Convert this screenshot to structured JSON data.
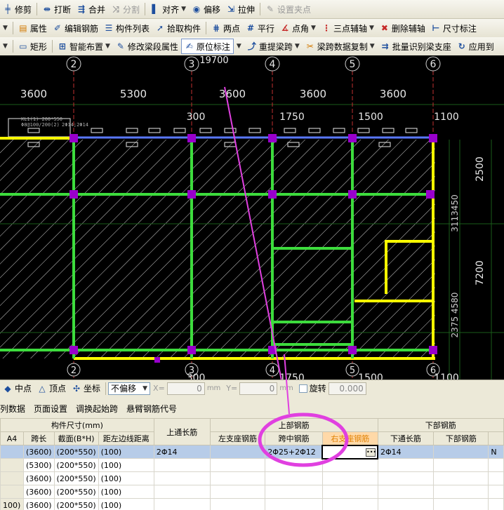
{
  "toolbar1": {
    "trim": "修剪",
    "break": "打断",
    "merge": "合并",
    "split": "分割",
    "align": "对齐",
    "offset": "偏移",
    "stretch": "拉伸",
    "set_grip": "设置夹点"
  },
  "toolbar2": {
    "properties": "属性",
    "edit_rebar": "编辑钢筋",
    "member_list": "构件列表",
    "pick_member": "拾取构件",
    "two_points": "两点",
    "parallel": "平行",
    "point_angle": "点角",
    "three_point_axis": "三点辅轴",
    "delete_axis": "删除辅轴",
    "dim_label": "尺寸标注"
  },
  "toolbar3": {
    "rectangle": "矩形",
    "smart_layout": "智能布置",
    "modify_span_props": "修改梁段属性",
    "in_situ_label": "原位标注",
    "re_extract_span": "重提梁跨",
    "copy_span_data": "梁跨数据复制",
    "batch_identify": "批量识别梁支座",
    "apply_to": "应用到"
  },
  "drawing": {
    "axis_top": [
      "2",
      "3",
      "4",
      "5",
      "6"
    ],
    "axis_bottom": [
      "2",
      "3",
      "4",
      "5",
      "6"
    ],
    "dim_overall": "19700",
    "spans_top": [
      "3600",
      "5300",
      "3600",
      "3600",
      "3600"
    ],
    "offsets": [
      "300",
      "1750",
      "1500",
      "1100"
    ],
    "offsets_bottom": [
      "300",
      "1750",
      "1500",
      "1100"
    ],
    "right_dims": [
      "2500",
      "7200"
    ],
    "right_vertical_1": "3113450",
    "right_vertical_2": "2375 4580",
    "beam_note_1": "KL1(1) 200*550",
    "beam_note_2": "Φ8@100/200(2)",
    "beam_note_3": "2Φ14;2Φ14"
  },
  "statusbar": {
    "midpoint": "中点",
    "vertex": "顶点",
    "coordinate": "坐标",
    "offset_mode": "不偏移",
    "x_label": "X=",
    "x_value": "0",
    "y_label": "Y=",
    "y_value": "0",
    "unit": "mm",
    "rotate": "旋转",
    "rotate_value": "0.000"
  },
  "grid_menu": {
    "column_data": "列数据",
    "page_setup": "页面设置",
    "adjust_start_span": "调换起始跨",
    "cantilever_code": "悬臂钢筋代号"
  },
  "grid": {
    "group_member_size": "构件尺寸(mm)",
    "group_top_through": "上通长筋",
    "group_top_rebar": "上部钢筋",
    "group_bottom_rebar": "下部钢筋",
    "col_a4": "A4",
    "col_span_length": "跨长",
    "col_section": "截面(B*H)",
    "col_dist_left": "距左边线距离",
    "col_left_support": "左支座钢筋",
    "col_mid_span": "跨中钢筋",
    "col_right_support": "右支座钢筋",
    "col_bottom_through": "下通长筋",
    "col_bottom_rebar": "下部钢筋",
    "rows": [
      {
        "a4": "",
        "span": "(3600)",
        "section": "(200*550)",
        "dist": "(100)",
        "top_through": "2Φ14",
        "left": "",
        "mid": "2Φ25+2Φ12",
        "right": "",
        "bottom_through": "2Φ14",
        "bottom": "",
        "extra": "N"
      },
      {
        "a4": "",
        "span": "(5300)",
        "section": "(200*550)",
        "dist": "(100)",
        "top_through": "",
        "left": "",
        "mid": "",
        "right": "",
        "bottom_through": "",
        "bottom": "",
        "extra": ""
      },
      {
        "a4": "",
        "span": "(3600)",
        "section": "(200*550)",
        "dist": "(100)",
        "top_through": "",
        "left": "",
        "mid": "",
        "right": "",
        "bottom_through": "",
        "bottom": "",
        "extra": ""
      },
      {
        "a4": "",
        "span": "(3600)",
        "section": "(200*550)",
        "dist": "(100)",
        "top_through": "",
        "left": "",
        "mid": "",
        "right": "",
        "bottom_through": "",
        "bottom": "",
        "extra": ""
      },
      {
        "a4": "100)",
        "span": "(3600)",
        "section": "(200*550)",
        "dist": "(100)",
        "top_through": "",
        "left": "",
        "mid": "",
        "right": "",
        "bottom_through": "",
        "bottom": "",
        "extra": ""
      }
    ]
  },
  "colors": {
    "beam_green": "#3ddc3d",
    "beam_yellow": "#ffff00",
    "column_purple": "#9900cc",
    "annotation_magenta": "#e040e0",
    "selection_blue": "#b7cce8"
  }
}
